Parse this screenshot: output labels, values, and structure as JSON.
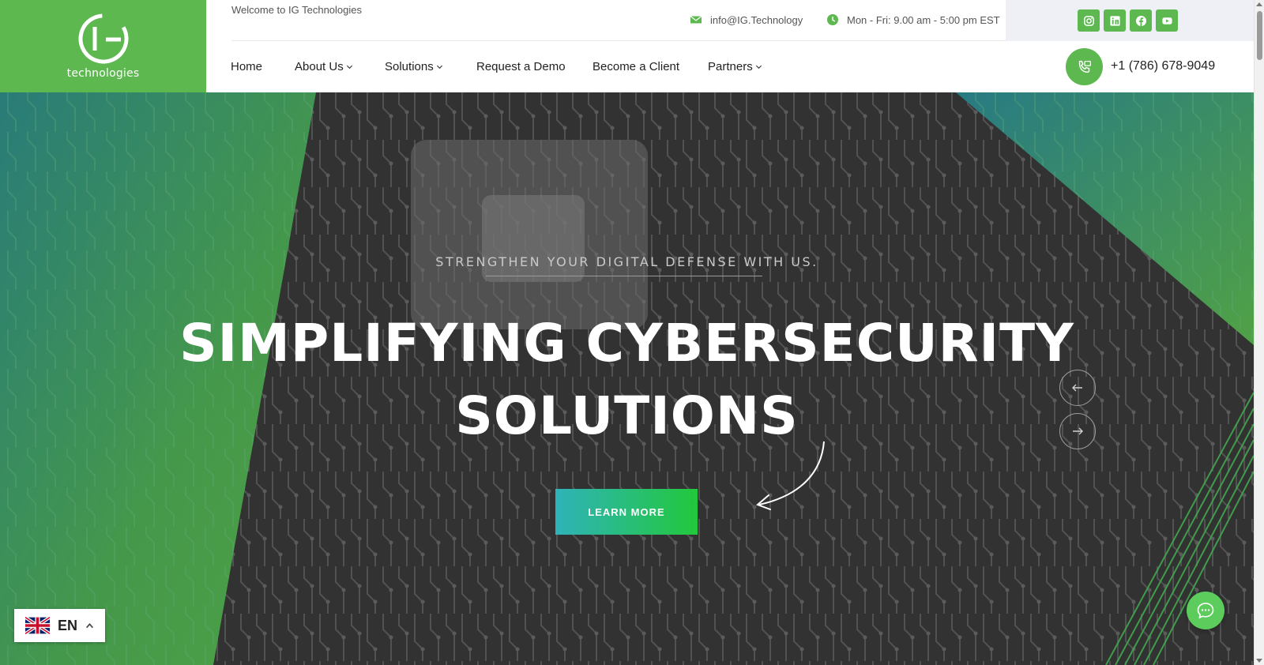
{
  "brand": {
    "logo_wordmark": "technologies",
    "accent_color": "#5cb84f"
  },
  "topbar": {
    "welcome": "Welcome to IG Technologies",
    "email": "info@IG.Technology",
    "hours": "Mon - Fri: 9.00 am - 5:00 pm EST",
    "email_icon": "envelope-icon",
    "hours_icon": "clock-icon"
  },
  "social": [
    {
      "name": "instagram-icon"
    },
    {
      "name": "linkedin-icon"
    },
    {
      "name": "facebook-icon"
    },
    {
      "name": "youtube-icon"
    }
  ],
  "nav": {
    "items": [
      {
        "label": "Home",
        "has_dropdown": false
      },
      {
        "label": "About Us",
        "has_dropdown": true
      },
      {
        "label": "Solutions",
        "has_dropdown": true
      },
      {
        "label": "Request a Demo",
        "has_dropdown": false
      },
      {
        "label": "Become a Client",
        "has_dropdown": false
      },
      {
        "label": "Partners",
        "has_dropdown": true
      }
    ],
    "phone": "+1 (786) 678-9049",
    "phone_icon": "phone-icon"
  },
  "hero": {
    "tagline": "STRENGTHEN YOUR DIGITAL DEFENSE WITH US.",
    "headline_line1": "SIMPLIFYING CYBERSECURITY",
    "headline_line2": "SOLUTIONS",
    "cta_label": "LEARN MORE",
    "prev_icon": "arrow-left-icon",
    "next_icon": "arrow-right-icon"
  },
  "language": {
    "code": "EN",
    "flag_icon": "uk-flag-icon"
  },
  "chat": {
    "icon": "chat-bubble-icon"
  }
}
